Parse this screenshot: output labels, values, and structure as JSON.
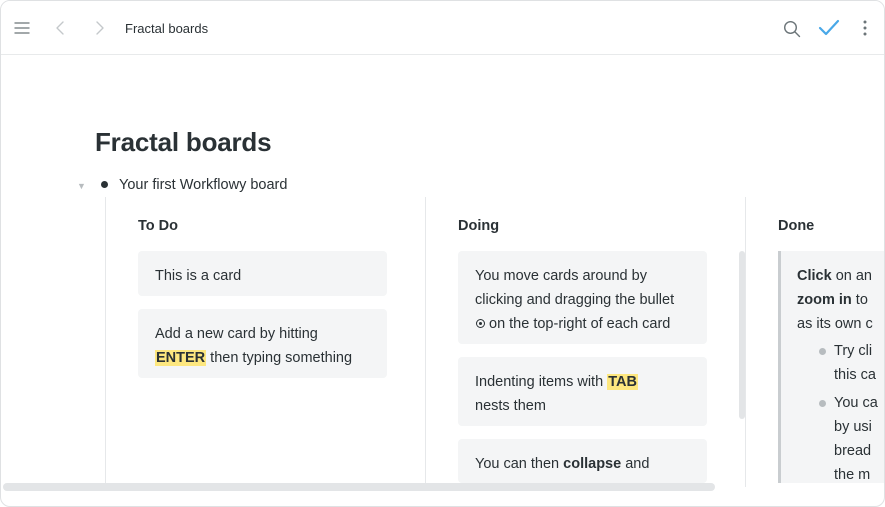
{
  "topbar": {
    "breadcrumb": "Fractal boards",
    "icons": [
      "menu-icon",
      "chevron-left-icon",
      "chevron-right-icon",
      "search-icon",
      "check-icon",
      "more-vertical-icon"
    ],
    "accent_color": "#49a8e8"
  },
  "page": {
    "title": "Fractal boards",
    "board_title": "Your first Workflowy board"
  },
  "columns": [
    {
      "title": "To Do",
      "cards": [
        {
          "text": "This is a card"
        },
        {
          "line1": "Add a new card by hitting",
          "hl": "ENTER",
          "line2_rest": " then typing something"
        }
      ]
    },
    {
      "title": "Doing",
      "cards": [
        {
          "line1": "You move cards around by",
          "line2": "clicking and dragging the bullet",
          "line3": "on the top-right of each card"
        },
        {
          "pre": "Indenting items with ",
          "hl": "TAB",
          "line2": "nests them"
        },
        {
          "pre": "You can then ",
          "bold": "collapse",
          "post": " and"
        }
      ]
    },
    {
      "title": "Done",
      "card": {
        "l1_bold": "Click",
        "l1_rest": " on an",
        "l2_bold": "zoom in",
        "l2_rest": " to",
        "l3": "as its own c",
        "sub1_l1": "Try cli",
        "sub1_l2": "this ca",
        "sub2_l1": "You ca",
        "sub2_l2": "by usi",
        "sub2_l3": "bread",
        "sub2_l4": "the m"
      }
    }
  ]
}
